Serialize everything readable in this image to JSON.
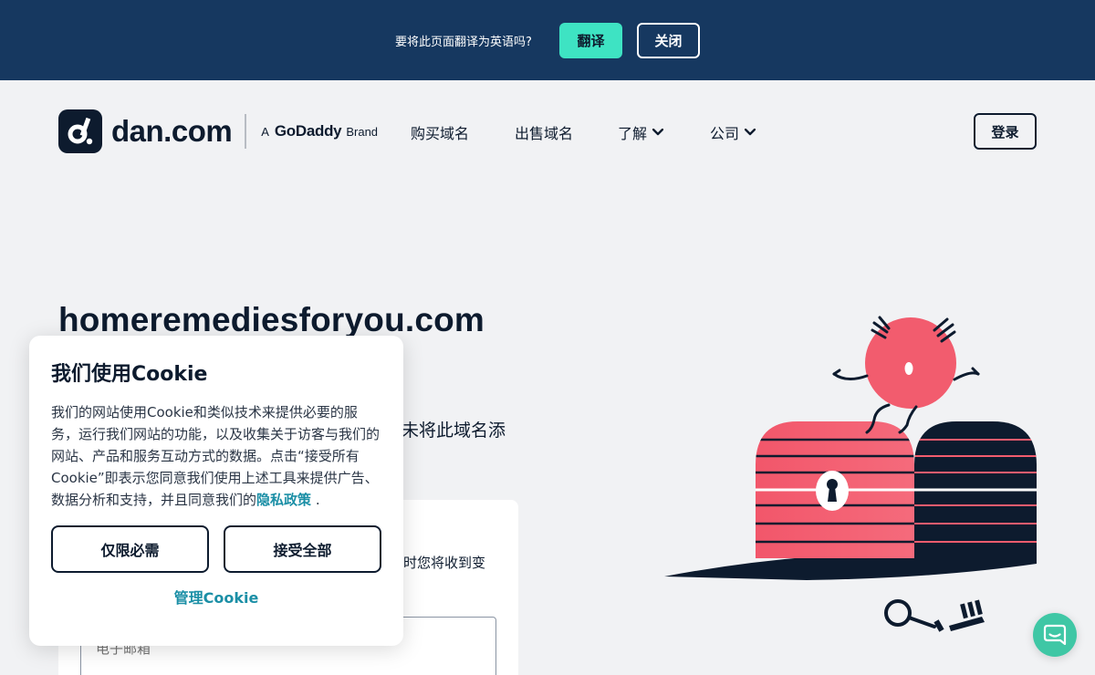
{
  "translate_bar": {
    "message": "要将此页面翻译为英语吗?",
    "translate_label": "翻译",
    "close_label": "关闭"
  },
  "header": {
    "logo_text": "dan.com",
    "brand_prefix": "A",
    "brand_name": "GoDaddy",
    "brand_suffix": "Brand",
    "nav": [
      {
        "label": "购买域名",
        "icon": ""
      },
      {
        "label": "出售域名",
        "icon": ""
      },
      {
        "label": "了解",
        "icon": "chevron-down-icon"
      },
      {
        "label": "公司",
        "icon": "chevron-down-icon"
      }
    ],
    "login_label": "登录"
  },
  "main": {
    "domain": "homeremediesforyou.com",
    "subtext": "未将此域名添",
    "card_text": "时您将收到变",
    "email_placeholder": "电子邮箱"
  },
  "cookie": {
    "title": "我们使用Cookie",
    "body": "我们的网站使用Cookie和类似技术来提供必要的服务，运行我们网站的功能，以及收集关于访客与我们的网站、产品和服务互动方式的数据。点击“接受所有Cookie”即表示您同意我们使用上述工具来提供广告、数据分析和支持，并且同意我们的",
    "privacy_link": "隐私政策",
    "period": ".",
    "necessary_label": "仅限必需",
    "accept_all_label": "接受全部",
    "manage_label": "管理Cookie"
  },
  "colors": {
    "topbar_bg": "#163860",
    "translate_btn": "#3ee3c3",
    "page_bg": "#f1f2f4",
    "ink": "#0d1b2e",
    "accent_link": "#1b8fa6",
    "chest_pink": "#f25c6e",
    "chat_green": "#3fc7a5"
  }
}
